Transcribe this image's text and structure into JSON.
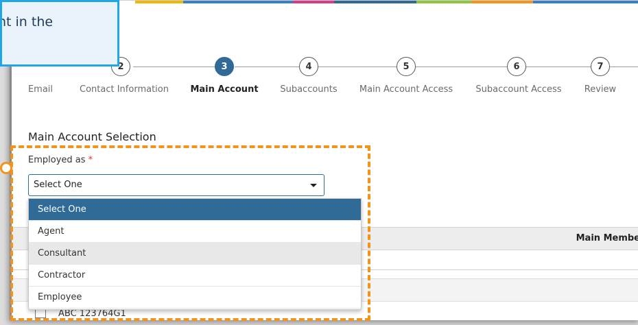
{
  "callout": {
    "text": "nt in the"
  },
  "stepper": {
    "steps": [
      {
        "number": "",
        "label": "Email"
      },
      {
        "number": "2",
        "label": "Contact Information"
      },
      {
        "number": "3",
        "label": "Main Account"
      },
      {
        "number": "4",
        "label": "Subaccounts"
      },
      {
        "number": "5",
        "label": "Main Account Access"
      },
      {
        "number": "6",
        "label": "Subaccount Access"
      },
      {
        "number": "7",
        "label": "Review"
      }
    ],
    "active_index": 2
  },
  "form": {
    "section_title": "Main Account Selection",
    "employed_label": "Employed as",
    "required_marker": "*",
    "select_value": "Select One",
    "options": [
      "Select One",
      "Agent",
      "Consultant",
      "Contractor",
      "Employee"
    ]
  },
  "table": {
    "header_partial": "Main Membe",
    "row_partial": "ABC 123764G1"
  },
  "colors": {
    "accent_blue": "#2f6b96",
    "callout_border": "#1da6e8",
    "highlight_orange": "#f39319",
    "required_red": "#d9342b"
  }
}
